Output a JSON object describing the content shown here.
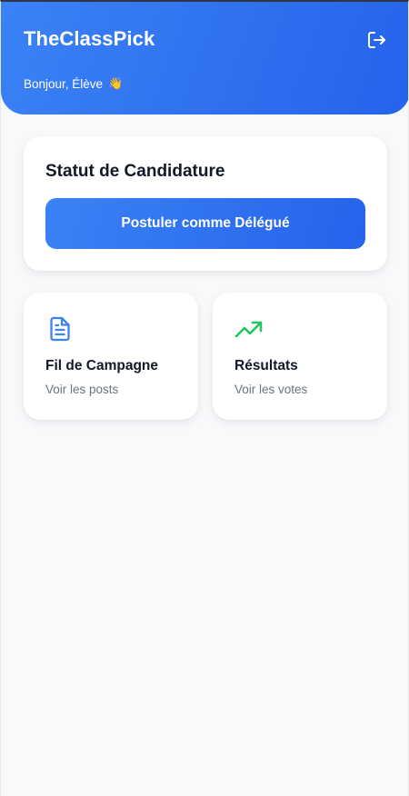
{
  "header": {
    "app_title": "TheClassPick",
    "greeting": "Bonjour, Élève",
    "greeting_emoji": "👋",
    "logout_icon": "logout-icon"
  },
  "status_card": {
    "title": "Statut de Candidature",
    "apply_button_label": "Postuler comme Délégué"
  },
  "tiles": [
    {
      "title": "Fil de Campagne",
      "subtitle": "Voir les posts",
      "icon": "document-icon",
      "icon_color": "#3b82f6"
    },
    {
      "title": "Résultats",
      "subtitle": "Voir les votes",
      "icon": "trending-up-icon",
      "icon_color": "#22c55e"
    }
  ],
  "colors": {
    "primary": "#3b82f6",
    "primary_dark": "#2563eb",
    "success": "#22c55e",
    "background": "#f8f9fb",
    "text": "#111827",
    "muted_text": "#6b7280"
  }
}
